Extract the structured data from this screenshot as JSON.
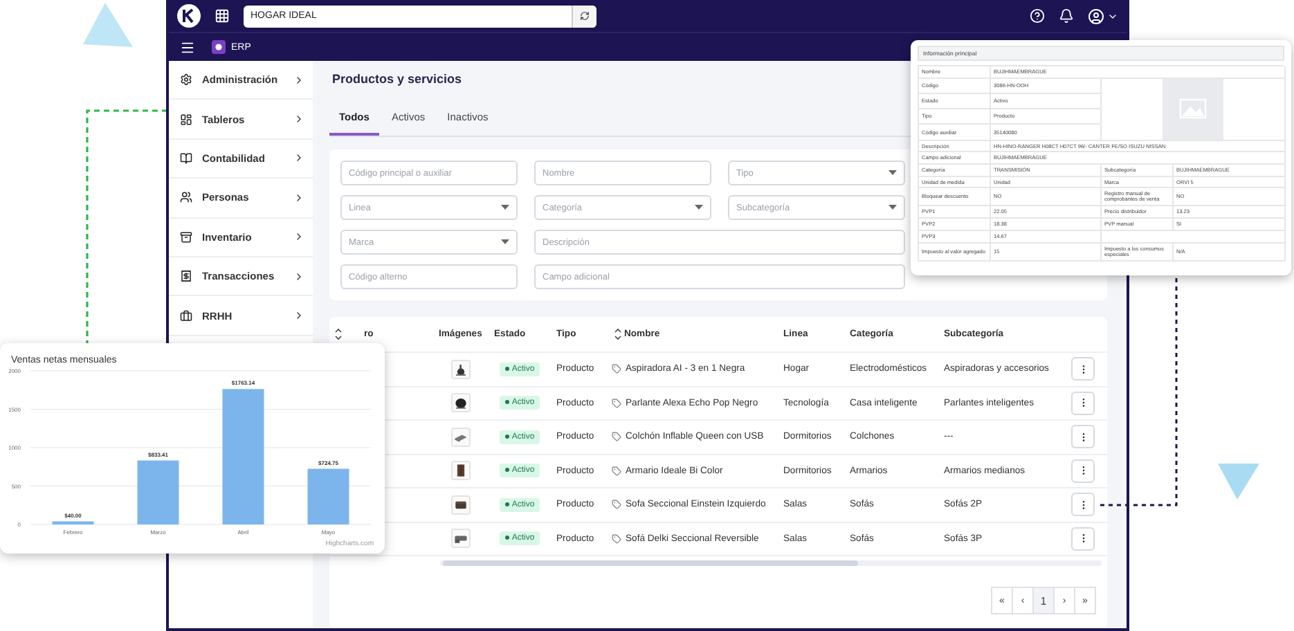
{
  "topbar": {
    "search_value": "HOGAR IDEAL",
    "module": "ERP"
  },
  "sidebar": {
    "items": [
      {
        "label": "Administración"
      },
      {
        "label": "Tableros"
      },
      {
        "label": "Contabilidad"
      },
      {
        "label": "Personas"
      },
      {
        "label": "Inventario"
      },
      {
        "label": "Transacciones"
      },
      {
        "label": "RRHH"
      }
    ]
  },
  "page_title": "Productos y servicios",
  "tabs": [
    {
      "label": "Todos",
      "selected": true
    },
    {
      "label": "Activos",
      "selected": false
    },
    {
      "label": "Inactivos",
      "selected": false
    }
  ],
  "filters": [
    {
      "kind": "input",
      "placeholder": "Código principal o auxiliar"
    },
    {
      "kind": "input",
      "placeholder": "Nombre"
    },
    {
      "kind": "select",
      "placeholder": "Tipo"
    },
    {
      "kind": "select",
      "placeholder": "Linea"
    },
    {
      "kind": "select",
      "placeholder": "Categoría"
    },
    {
      "kind": "select",
      "placeholder": "Subcategoría"
    },
    {
      "kind": "select",
      "placeholder": "Marca"
    },
    {
      "kind": "wide",
      "placeholder": "Descripción"
    },
    {
      "kind": "input",
      "placeholder": "Código alterno"
    },
    {
      "kind": "wide",
      "placeholder": "Campo adicional"
    }
  ],
  "table": {
    "columns": [
      {
        "label": "ro",
        "sortable": true
      },
      {
        "label": "Imágenes",
        "sortable": false
      },
      {
        "label": "Estado",
        "sortable": false
      },
      {
        "label": "Tipo",
        "sortable": false
      },
      {
        "label": "Nombre",
        "sortable": true
      },
      {
        "label": "Linea",
        "sortable": false
      },
      {
        "label": "Categoría",
        "sortable": false
      },
      {
        "label": "Subcategoría",
        "sortable": false
      }
    ],
    "rows": [
      {
        "status": "Activo",
        "type": "Producto",
        "name": "Aspiradora AI - 3 en 1 Negra",
        "line": "Hogar",
        "category": "Electrodomésticos",
        "subcategory": "Aspiradoras y accesorios"
      },
      {
        "status": "Activo",
        "type": "Producto",
        "name": "Parlante Alexa Echo Pop Negro",
        "line": "Tecnología",
        "category": "Casa inteligente",
        "subcategory": "Parlantes inteligentes"
      },
      {
        "status": "Activo",
        "type": "Producto",
        "name": "Colchón Inflable Queen con USB",
        "line": "Dormitorios",
        "category": "Colchones",
        "subcategory": "---"
      },
      {
        "status": "Activo",
        "type": "Producto",
        "name": "Armario Ideale Bi Color",
        "line": "Dormitorios",
        "category": "Armarios",
        "subcategory": "Armarios medianos"
      },
      {
        "status": "Activo",
        "type": "Producto",
        "name": "Sofa Seccional Einstein Izquierdo",
        "line": "Salas",
        "category": "Sofás",
        "subcategory": "Sofás 2P"
      },
      {
        "status": "Activo",
        "type": "Producto",
        "name": "Sofá Delki Seccional Reversible",
        "line": "Salas",
        "category": "Sofás",
        "subcategory": "Sofás 3P"
      }
    ]
  },
  "pagination": [
    {
      "label": "«",
      "selected": false
    },
    {
      "label": "‹",
      "selected": false
    },
    {
      "label": "1",
      "selected": true
    },
    {
      "label": "›",
      "selected": false
    },
    {
      "label": "»",
      "selected": false
    }
  ],
  "sales_chart": {
    "credit": "Highcharts.com",
    "chart_data": {
      "type": "bar",
      "title": "Ventas netas mensuales",
      "categories": [
        "Febrero",
        "Marzo",
        "Abril",
        "Mayo"
      ],
      "series": [
        {
          "color": "#7cb5ec",
          "values": [
            40,
            833,
            1763,
            725
          ]
        }
      ],
      "ylim": [
        0,
        2000
      ],
      "yticks": [
        0,
        500,
        1000,
        1500,
        2000
      ],
      "grid": true,
      "value_labels": [
        "$40.00",
        "$833.41",
        "$1763.14",
        "$724.75"
      ]
    }
  },
  "info_card": {
    "title": "Información principal",
    "header_row": {
      "label": "Nombre",
      "value": "BUJIHMAEMBRAGUE"
    },
    "side_rows": [
      {
        "label": "Código",
        "value": "3086-HN-OOH"
      },
      {
        "label": "Estado",
        "value": "Activo"
      },
      {
        "label": "Tipo",
        "value": "Producto"
      },
      {
        "label": "Código auxiliar",
        "value": "35140080"
      }
    ],
    "full_rows": [
      {
        "label": "Descripción",
        "value": "HN-HINO-RANGER H08CT H07CT 96/- CANTER FE/SO ISUZU NISSAN"
      },
      {
        "label": "Campo adicional",
        "value": "BUJIHMAEMBRAGUE"
      }
    ],
    "pair_rows": [
      [
        {
          "label": "Categoría",
          "value": "TRANSMISIÓN"
        },
        {
          "label": "Subcategoría",
          "value": "BUJIHMAEMBRAGUE"
        }
      ],
      [
        {
          "label": "Unidad de medida",
          "value": "Unidad"
        },
        {
          "label": "Marca",
          "value": "ORVI 5"
        }
      ],
      [
        {
          "label": "Bloquear descuento",
          "value": "NO"
        },
        {
          "label": "Registro manual de comprobantes de venta",
          "value": "NO"
        }
      ],
      [
        {
          "label": "PVP1",
          "value": "22.05"
        },
        {
          "label": "Precio distribuidor",
          "value": "13.23"
        }
      ],
      [
        {
          "label": "PVP2",
          "value": "18.38"
        },
        {
          "label": "PVP manual",
          "value": "SI"
        }
      ],
      [
        {
          "label": "PVP3",
          "value": "14.67"
        }
      ],
      [
        {
          "label": "Impuesto al valor agregado",
          "value": "15"
        },
        {
          "label": "Impuesto a los consumos especiales",
          "value": "N/A"
        }
      ]
    ]
  }
}
